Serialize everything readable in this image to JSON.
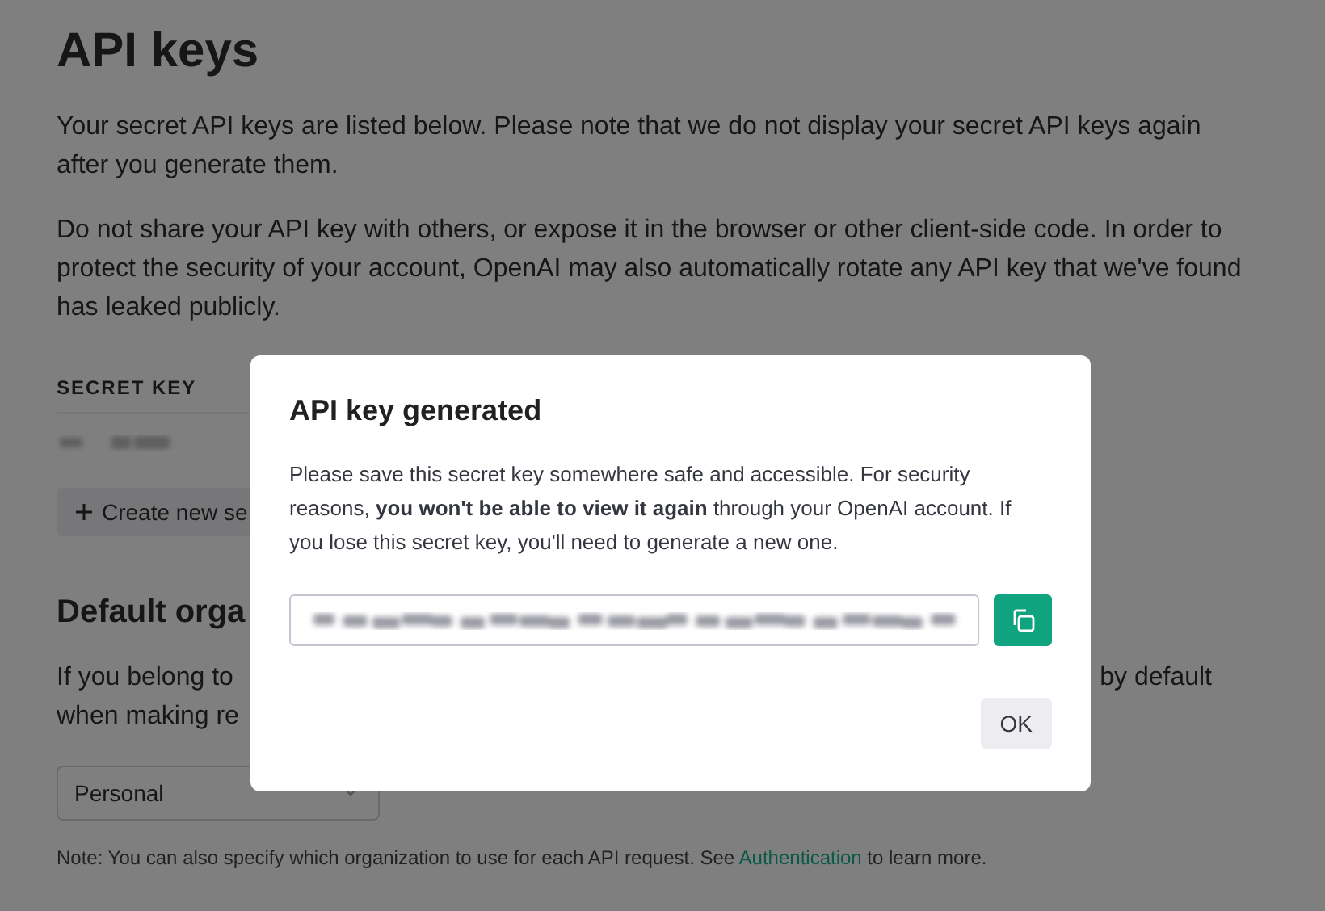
{
  "page": {
    "title": "API keys",
    "paragraphs": [
      "Your secret API keys are listed below. Please note that we do not display your secret API keys again after you generate them.",
      "Do not share your API key with others, or expose it in the browser or other client-side code. In order to protect the security of your account, OpenAI may also automatically rotate any API key that we've found has leaked publicly."
    ]
  },
  "keys_table": {
    "columns": [
      "SECRET KEY"
    ]
  },
  "create_button": {
    "label": "Create new se"
  },
  "default_org": {
    "heading": "Default orga",
    "lines_left": [
      "If you belong to",
      "when making re"
    ],
    "line_right": "by default",
    "select": {
      "value": "Personal"
    },
    "note": {
      "before": "Note: You can also specify which organization to use for each API request. See ",
      "link": "Authentication",
      "after": " to learn more."
    }
  },
  "modal": {
    "title": "API key generated",
    "body": "Please save this secret key somewhere safe and accessible. For security reasons, **you won't be able to view it again** through your OpenAI account. If you lose this secret key, you'll need to generate a new one.",
    "ok_button": "OK"
  }
}
